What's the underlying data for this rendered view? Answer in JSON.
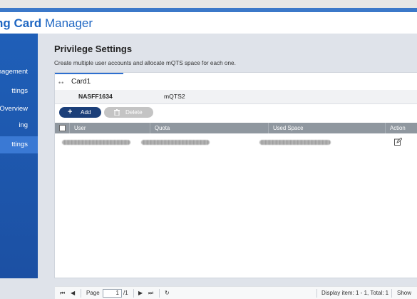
{
  "app": {
    "title_bold": "ng Card",
    "title_rest": " Manager"
  },
  "sidebar": {
    "items": [
      {
        "label": "anagement",
        "active": false
      },
      {
        "label": "ttings",
        "active": false
      },
      {
        "label": "Overview",
        "active": false
      },
      {
        "label": "ing",
        "active": false
      },
      {
        "label": "ttings",
        "active": true
      }
    ]
  },
  "main": {
    "title": "Privilege Settings",
    "description": "Create multiple user accounts and allocate mQTS space for each one.",
    "card_tab": {
      "dots": "••",
      "label": "Card1"
    },
    "subtabs": [
      "NASFF1634",
      "mQTS2"
    ],
    "buttons": {
      "add": "Add",
      "delete": "Delete"
    },
    "table": {
      "columns": [
        "User",
        "Quota",
        "Used Space",
        "Action"
      ],
      "rows": [
        {
          "user": "",
          "quota": "",
          "used_space": ""
        }
      ]
    },
    "footer": {
      "page_label": "Page",
      "page_value": "1",
      "page_total": "/1",
      "display_info": "Display item: 1 - 1, Total: 1",
      "show_label": "Show"
    }
  }
}
